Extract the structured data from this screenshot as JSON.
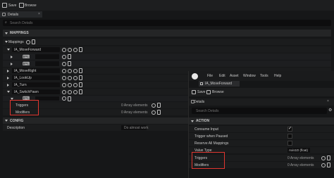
{
  "left": {
    "toolbar": {
      "save": "Save",
      "browse": "Browse"
    },
    "tab": "Details",
    "search_placeholder": "Search Details",
    "section_mappings": "MAPPINGS",
    "mappings_label": "Mappings",
    "mapping_values": [
      "IA_MoveForward",
      "IA_MoveRight",
      "IA_LookUp",
      "IA_Turn",
      "IA_SwitchPawn"
    ],
    "triggers_label": "Triggers",
    "modifiers_label": "Modifiers",
    "triggers_value": "0 Array elements",
    "modifiers_value": "0 Array elements",
    "section_config": "CONFIG",
    "description_label": "Description",
    "description_placeholder": "Do almost work"
  },
  "right": {
    "menu": [
      "File",
      "Edit",
      "Asset",
      "Window",
      "Tools",
      "Help"
    ],
    "asset_tab": "IA_MoveForward",
    "toolbar": {
      "save": "Save",
      "browse": "Browse"
    },
    "tab": "Details",
    "search_placeholder": "Search Details",
    "section_action": "ACTION",
    "props": [
      {
        "label": "Consume Input",
        "value": "",
        "checked": true
      },
      {
        "label": "Trigger when Paused",
        "value": "",
        "checked": false
      },
      {
        "label": "Reserve All Mappings",
        "value": "",
        "checked": false
      },
      {
        "label": "Value Type",
        "value": "Axis1D (float)",
        "checked": false
      }
    ],
    "triggers_label": "Triggers",
    "modifiers_label": "Modifiers",
    "triggers_value": "0 Array elements",
    "modifiers_value": "0 Array elements"
  }
}
